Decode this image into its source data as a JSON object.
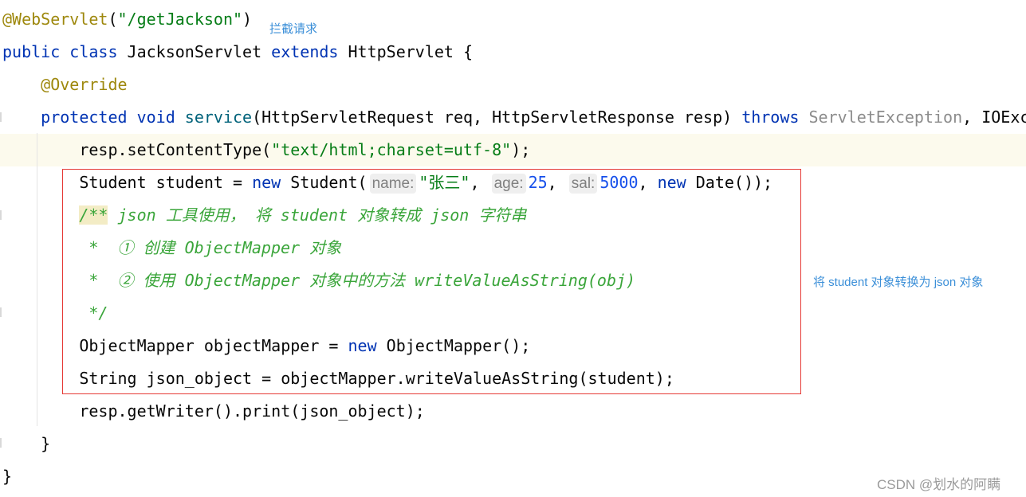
{
  "editor": {
    "highlighted_line": 4,
    "lines": [
      [
        [
          "an",
          "@WebServlet"
        ],
        [
          "",
          "("
        ],
        [
          "str",
          "\"/getJackson\""
        ],
        [
          "",
          ")"
        ]
      ],
      [
        [
          "kw",
          "public class "
        ],
        [
          "",
          "JacksonServlet "
        ],
        [
          "kw",
          "extends "
        ],
        [
          "",
          "HttpServlet {"
        ]
      ],
      [
        [
          "",
          "    "
        ],
        [
          "an",
          "@Override"
        ]
      ],
      [
        [
          "",
          "    "
        ],
        [
          "kw",
          "protected void "
        ],
        [
          "fn",
          "service"
        ],
        [
          "",
          "(HttpServletRequest req, HttpServletResponse resp) "
        ],
        [
          "kw",
          "throws "
        ],
        [
          "dim",
          "ServletException"
        ],
        [
          "",
          ", IOExc"
        ]
      ],
      [
        [
          "",
          "        resp.setContentType("
        ],
        [
          "str",
          "\"text/html;charset=utf-8\""
        ],
        [
          "",
          ");"
        ]
      ],
      [
        [
          "",
          "        Student student = "
        ],
        [
          "kw",
          "new "
        ],
        [
          "",
          "Student("
        ],
        [
          "hint",
          "name:"
        ],
        [
          "str",
          "\"张三\""
        ],
        [
          "",
          ", "
        ],
        [
          "hint",
          "age:"
        ],
        [
          "num",
          "25"
        ],
        [
          "",
          ", "
        ],
        [
          "hint",
          "sal:"
        ],
        [
          "num",
          "5000"
        ],
        [
          "",
          ", "
        ],
        [
          "kw",
          "new "
        ],
        [
          "",
          "Date());"
        ]
      ],
      [
        [
          "",
          "        "
        ],
        [
          "cmh",
          "/**"
        ],
        [
          "cm",
          " json 工具使用， 将 student 对象转成 json 字符串"
        ]
      ],
      [
        [
          "",
          "        "
        ],
        [
          "cm",
          " *  ① 创建 ObjectMapper 对象"
        ]
      ],
      [
        [
          "",
          "        "
        ],
        [
          "cm",
          " *  ② 使用 ObjectMapper 对象中的方法 writeValueAsString(obj)"
        ]
      ],
      [
        [
          "",
          "        "
        ],
        [
          "cm",
          " */"
        ]
      ],
      [
        [
          "",
          "        ObjectMapper objectMapper = "
        ],
        [
          "kw",
          "new "
        ],
        [
          "",
          "ObjectMapper();"
        ]
      ],
      [
        [
          "",
          "        String json_object = objectMapper.writeValueAsString(student);"
        ]
      ],
      [
        [
          "",
          "        resp.getWriter().print(json_object);"
        ]
      ],
      [
        [
          "",
          "    }"
        ]
      ],
      [
        [
          "",
          "}"
        ]
      ]
    ]
  },
  "annotations": {
    "intercept_note": "拦截请求",
    "convert_note": "将 student 对象转换为 json 对象"
  },
  "watermark": "CSDN @划水的阿瞒",
  "colors": {
    "box": "#e53935",
    "note": "#3b8fd8"
  }
}
